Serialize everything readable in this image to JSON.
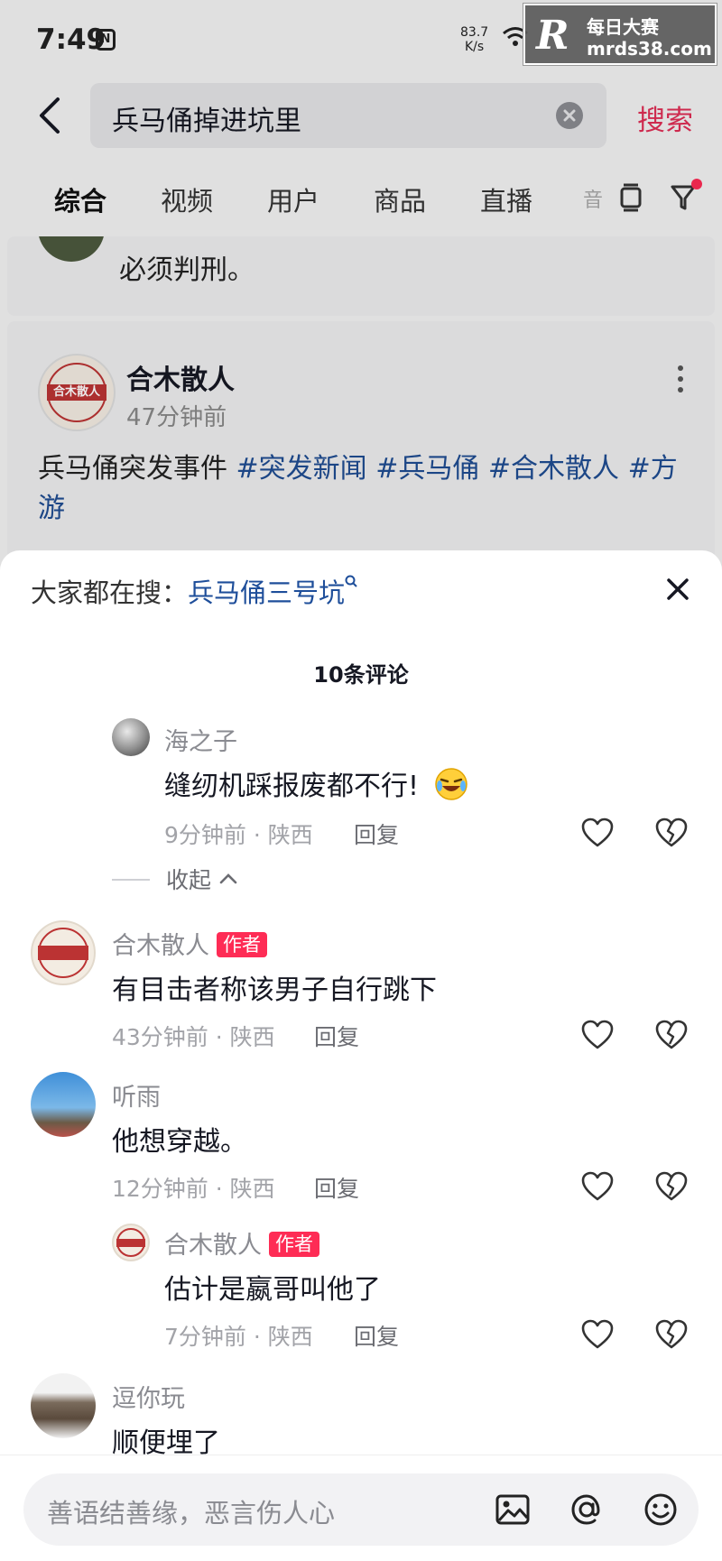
{
  "status_bar": {
    "time": "7:49",
    "nfc_icon": "nfc-icon",
    "net_speed_value": "83.7",
    "net_speed_unit": "K/s"
  },
  "watermark": {
    "logo_letter": "R",
    "title": "每日大赛",
    "url": "mrds38.com"
  },
  "search": {
    "query": "兵马俑掉进坑里",
    "button_label": "搜索"
  },
  "tabs": [
    {
      "label": "综合",
      "active": true
    },
    {
      "label": "视频"
    },
    {
      "label": "用户"
    },
    {
      "label": "商品"
    },
    {
      "label": "直播"
    },
    {
      "label": "音"
    }
  ],
  "previous_card": {
    "text": "必须判刑。"
  },
  "post": {
    "author": "合木散人",
    "time": "47分钟前",
    "body_text": "兵马俑突发事件",
    "hashtags": [
      "#突发新闻",
      "#兵马俑",
      "#合木散人",
      "#方游"
    ],
    "avatar_seal_text": "合木散人"
  },
  "sheet": {
    "hot_search_prefix": "大家都在搜：",
    "hot_search_term": "兵马俑三号坑",
    "comment_count": "10条评论",
    "collapse_label": "收起"
  },
  "comments": [
    {
      "name": "海之子",
      "text": "缝纫机踩报废都不行!",
      "time": "9分钟前",
      "location": "陕西",
      "reply": "回复",
      "is_reply": true
    },
    {
      "name": "合木散人",
      "badge": "作者",
      "text": "有目击者称该男子自行跳下",
      "time": "43分钟前",
      "location": "陕西",
      "reply": "回复",
      "is_reply": false
    },
    {
      "name": "听雨",
      "text": "他想穿越。",
      "time": "12分钟前",
      "location": "陕西",
      "reply": "回复",
      "is_reply": false
    },
    {
      "name": "合木散人",
      "badge": "作者",
      "text": "估计是嬴哥叫他了",
      "time": "7分钟前",
      "location": "陕西",
      "reply": "回复",
      "is_reply": true
    },
    {
      "name": "逗你玩",
      "text": "顺便埋了",
      "is_reply": false
    }
  ],
  "meta_separator": "·",
  "input": {
    "placeholder": "善语结善缘，恶言伤人心"
  },
  "colors": {
    "accent": "#fe2c55",
    "search_button": "#e02e55",
    "hashtag": "#1f4d92",
    "hot_link": "#1e4e9a"
  }
}
